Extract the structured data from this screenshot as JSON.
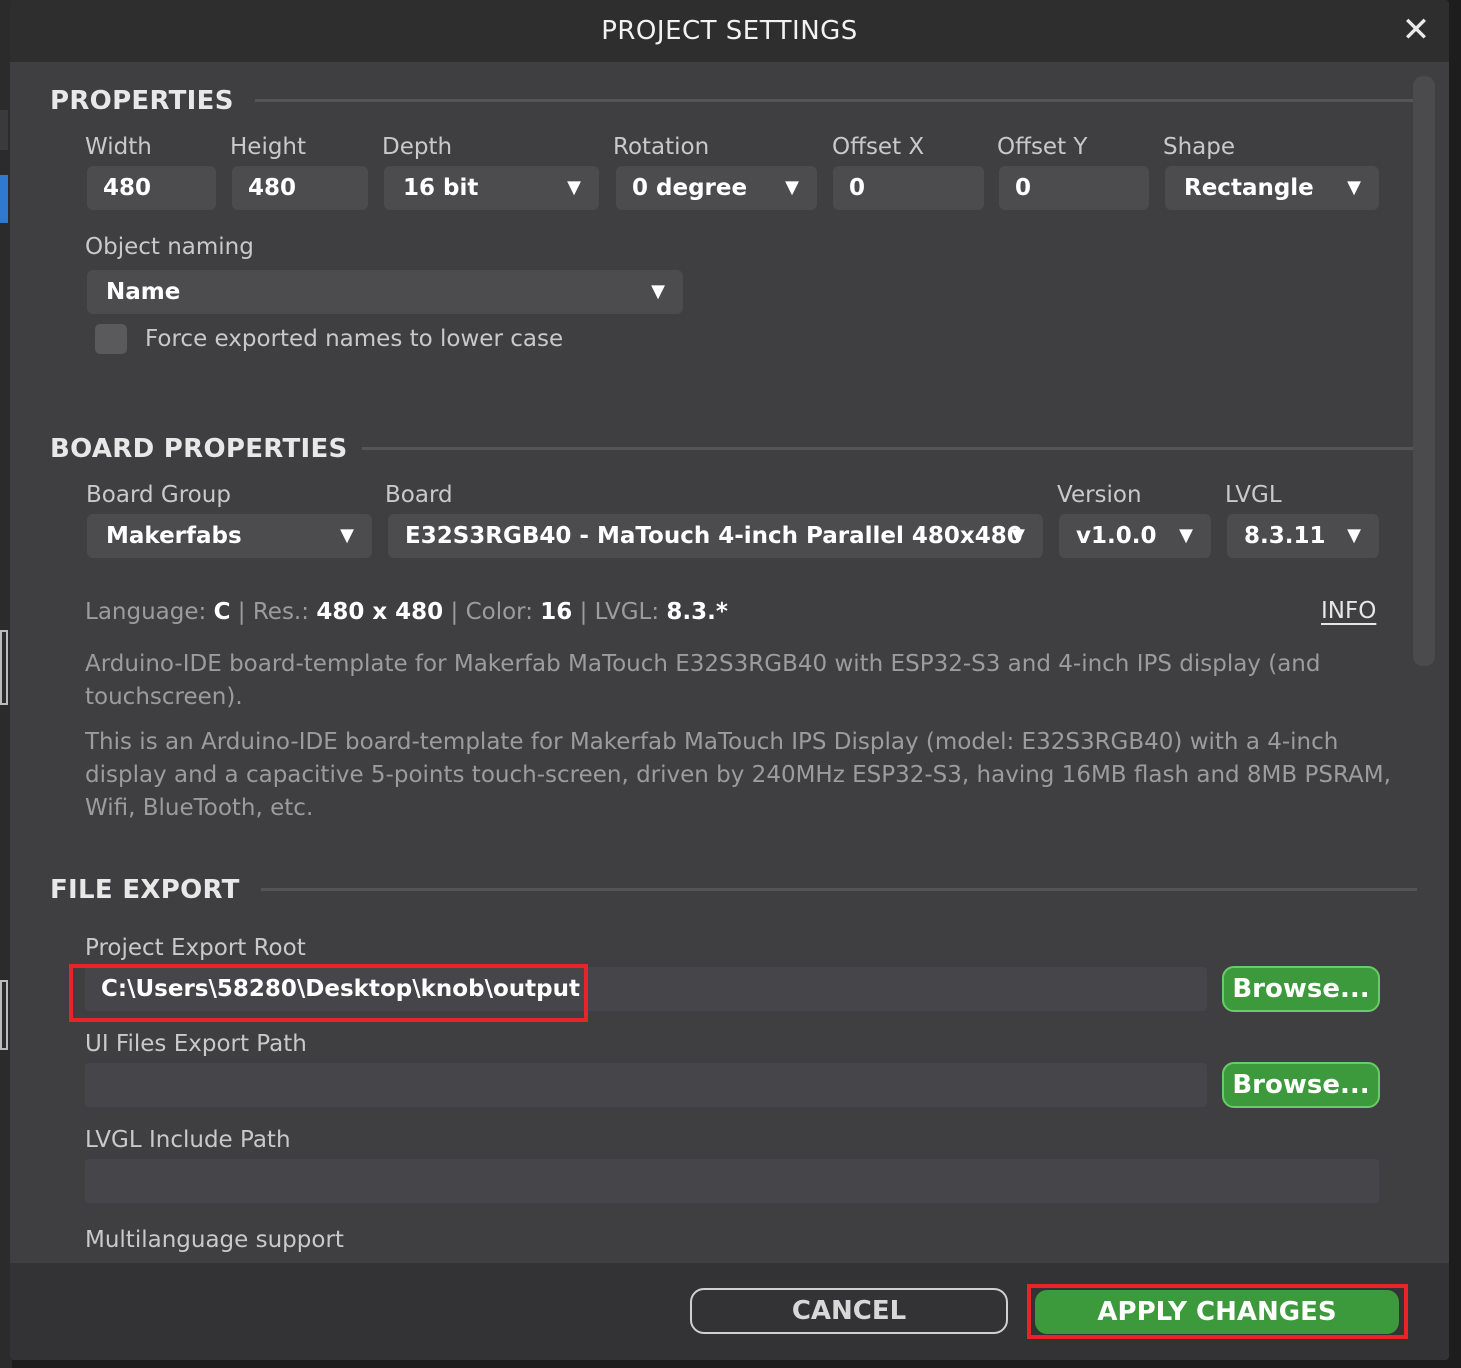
{
  "dialog": {
    "title": "PROJECT SETTINGS",
    "close_symbol": "✕"
  },
  "properties": {
    "section_title": "PROPERTIES",
    "width_label": "Width",
    "width_value": "480",
    "height_label": "Height",
    "height_value": "480",
    "depth_label": "Depth",
    "depth_value": "16 bit",
    "rotation_label": "Rotation",
    "rotation_value": "0 degree",
    "offset_x_label": "Offset X",
    "offset_x_value": "0",
    "offset_y_label": "Offset Y",
    "offset_y_value": "0",
    "shape_label": "Shape",
    "shape_value": "Rectangle",
    "naming_label": "Object naming",
    "naming_value": "Name",
    "lowercase_label": "Force exported names to lower case",
    "lowercase_checked": false
  },
  "board": {
    "section_title": "BOARD PROPERTIES",
    "group_label": "Board Group",
    "group_value": "Makerfabs",
    "board_label": "Board",
    "board_value": "E32S3RGB40 - MaTouch 4-inch Parallel 480x480",
    "version_label": "Version",
    "version_value": "v1.0.0",
    "lvgl_label": "LVGL",
    "lvgl_value": "8.3.11",
    "lang_label": "Language:",
    "lang_value": "C",
    "res_label": "Res.:",
    "res_value": "480 x 480",
    "color_label": "Color:",
    "color_value": "16",
    "lvgl_info_label": "LVGL:",
    "lvgl_info_value": "8.3.*",
    "separator": "|",
    "info_link": "INFO",
    "description_1": "Arduino-IDE board-template for Makerfab MaTouch E32S3RGB40 with ESP32-S3 and 4-inch IPS display (and touchscreen).",
    "description_2": "This is an Arduino-IDE board-template for Makerfab MaTouch IPS Display (model: E32S3RGB40) with a 4-inch display and a capacitive 5-points touch-screen, driven by 240MHz ESP32-S3, having 16MB flash and 8MB PSRAM, Wifi, BlueTooth, etc."
  },
  "file_export": {
    "section_title": "FILE EXPORT",
    "root_label": "Project Export Root",
    "root_value": "C:\\Users\\58280\\Desktop\\knob\\output",
    "ui_label": "UI Files Export Path",
    "ui_value": "",
    "lvgl_include_label": "LVGL Include Path",
    "lvgl_include_value": "",
    "multilang_label": "Multilanguage support",
    "browse_label": "Browse..."
  },
  "footer": {
    "cancel_label": "CANCEL",
    "apply_label": "APPLY CHANGES"
  },
  "icons": {
    "dropdown_arrow": "▼"
  },
  "colors": {
    "accent_green": "#3c9a3c",
    "highlight_red": "#e8242b"
  }
}
